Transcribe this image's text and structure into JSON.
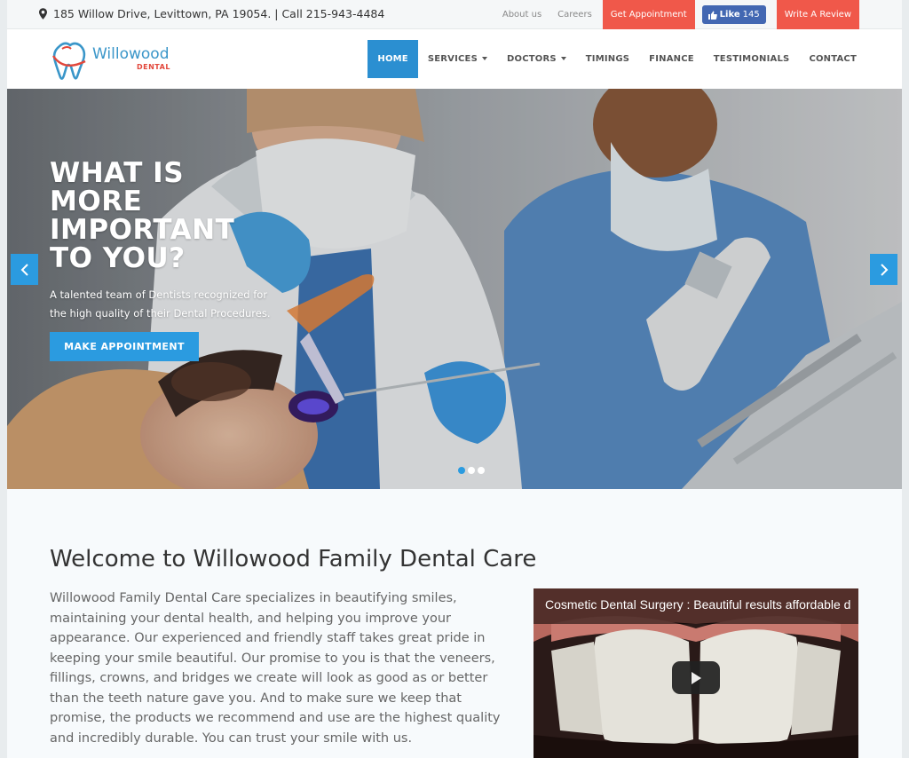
{
  "topbar": {
    "address": "185 Willow Drive, Levittown, PA 19054. | Call 215-943-4484",
    "links": [
      "About us",
      "Careers"
    ],
    "appointment_btn": "Get Appointment",
    "like_label": "Like",
    "like_count": "145",
    "review_btn": "Write A Review"
  },
  "logo": {
    "name": "Willowood",
    "sub": "DENTAL"
  },
  "nav": {
    "items": [
      {
        "label": "HOME",
        "active": true
      },
      {
        "label": "SERVICES",
        "dropdown": true
      },
      {
        "label": "DOCTORS",
        "dropdown": true
      },
      {
        "label": "TIMINGS"
      },
      {
        "label": "FINANCE"
      },
      {
        "label": "TESTIMONIALS"
      },
      {
        "label": "CONTACT"
      }
    ]
  },
  "hero": {
    "title": "WHAT IS MORE IMPORTANT TO YOU?",
    "subtitle": "A talented team of Dentists recognized for the high quality of their Dental Procedures.",
    "button": "MAKE APPOINTMENT",
    "slides": 3,
    "active_slide": 1
  },
  "welcome": {
    "heading": "Welcome to Willowood Family Dental Care",
    "body": "Willowood Family Dental Care specializes in beautifying smiles, maintaining your dental health, and helping you improve your appearance. Our experienced and friendly staff takes great pride in keeping your smile beautiful. Our promise to you is that the veneers, fillings, crowns, and bridges we create will look as good as or better than the teeth nature gave you. And to make sure we keep that promise, the products we recommend and use are the highest quality and incredibly durable. You can trust your smile with us.",
    "video_title": "Cosmetic Dental Surgery : Beautiful results affordable d"
  },
  "colors": {
    "accent": "#2b9be0",
    "red": "#f0584a",
    "facebook": "#4267b2"
  }
}
